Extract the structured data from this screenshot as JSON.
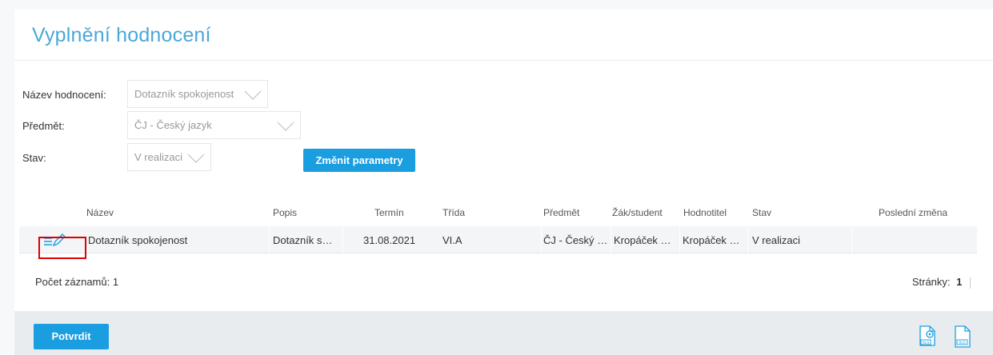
{
  "page": {
    "title": "Vyplnění hodnocení"
  },
  "form": {
    "evaluation_label": "Název hodnocení:",
    "evaluation_value": "Dotazník spokojenost",
    "subject_label": "Předmět:",
    "subject_value": "ČJ - Český jazyk",
    "state_label": "Stav:",
    "state_value": "V realizaci",
    "change_button": "Změnit parametry"
  },
  "table": {
    "columns": [
      "Název",
      "Popis",
      "Termín",
      "Třída",
      "Předmět",
      "Žák/student",
      "Hodnotitel",
      "Stav",
      "Poslední změna"
    ],
    "rows": [
      {
        "name": "Dotazník spokojenost",
        "description": "Dotazník s…",
        "term": "31.08.2021",
        "class": "VI.A",
        "subject": "ČJ - Český …",
        "student": "Kropáček …",
        "evaluator": "Kropáček …",
        "state": "V realizaci",
        "last_change": ""
      }
    ]
  },
  "records": {
    "count_label": "Počet záznamů: 1",
    "pages_label": "Stránky:",
    "page_number": "1"
  },
  "footer": {
    "confirm_button": "Potvrdit",
    "export_icon_label": "XLS",
    "file_icon_label": "XLS"
  },
  "colors": {
    "accent": "#1a9ee0",
    "title": "#4aa8d8",
    "highlight_border": "#e00000"
  },
  "icons": {
    "edit": "edit-pencil-icon",
    "export": "xls-export-settings-icon",
    "file": "xls-file-icon",
    "chevron": "chevron-down-icon"
  }
}
